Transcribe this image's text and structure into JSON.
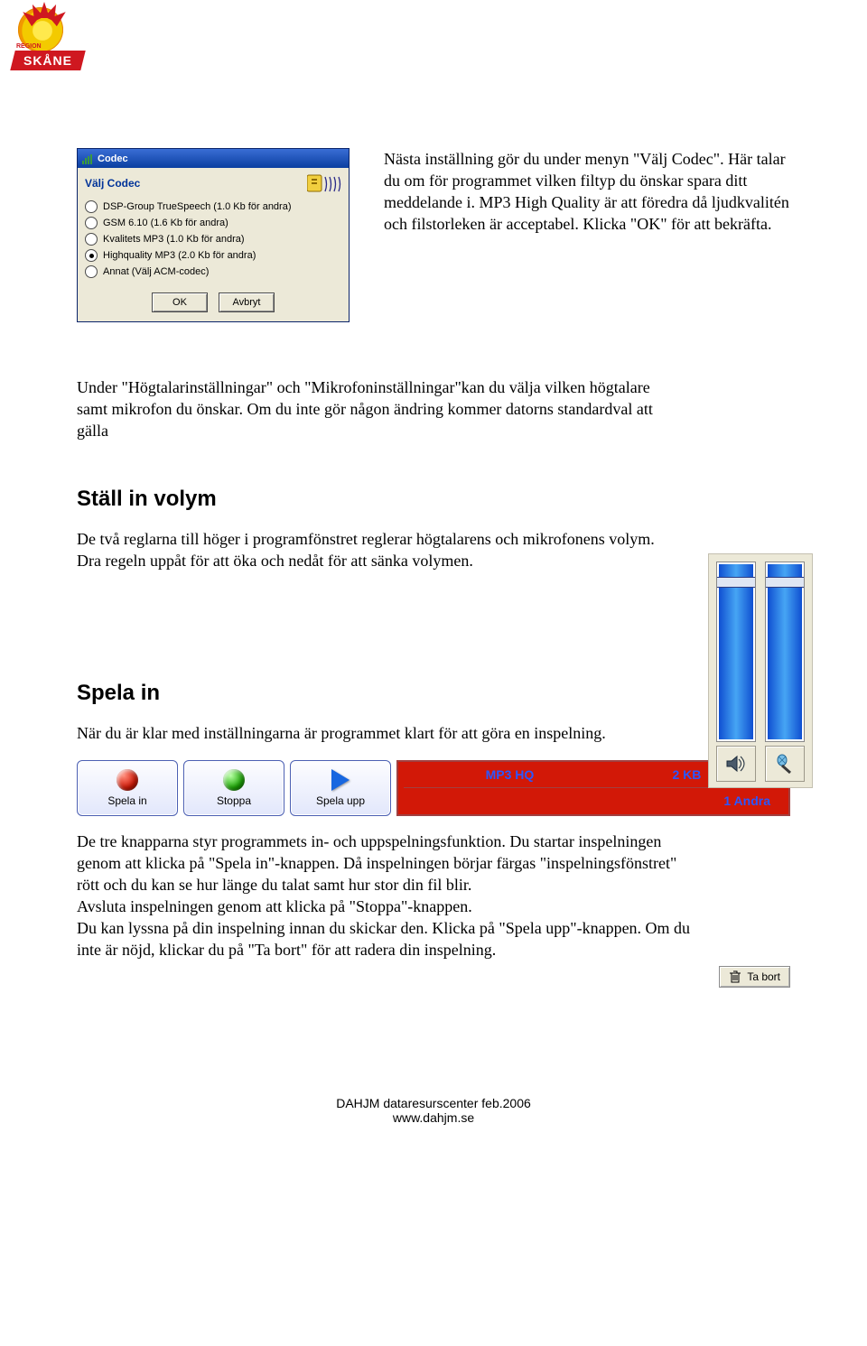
{
  "logo": {
    "region": "REGION",
    "brand": "SKÅNE"
  },
  "codec": {
    "window_title": "Codec",
    "heading": "Välj Codec",
    "options": [
      {
        "label": "DSP-Group TrueSpeech (1.0 Kb för andra)",
        "selected": false
      },
      {
        "label": "GSM 6.10 (1.6 Kb för andra)",
        "selected": false
      },
      {
        "label": "Kvalitets MP3 (1.0 Kb för andra)",
        "selected": false
      },
      {
        "label": "Highquality MP3 (2.0 Kb för andra)",
        "selected": true
      },
      {
        "label": "Annat (Välj ACM-codec)",
        "selected": false
      }
    ],
    "ok": "OK",
    "cancel": "Avbryt"
  },
  "para1": "Nästa inställning gör du under menyn \"Välj Codec\". Här talar du om för programmet vilken filtyp du önskar spara ditt meddelande i. MP3 High Quality är att föredra då ljudkvalitén och filstorleken är acceptabel. Klicka \"OK\" för att bekräfta.",
  "para2": "Under \"Högtalarinställningar\" och \"Mikrofoninställningar\"kan du välja vilken högtalare samt mikrofon du önskar. Om du inte gör någon ändring kommer datorns standardval att gälla",
  "vol": {
    "heading": "Ställ in volym",
    "text": "De två reglarna till höger i programfönstret reglerar högtalarens och mikrofonens volym. Dra regeln uppåt för att öka och nedåt för att sänka volymen."
  },
  "rec": {
    "heading": "Spela in",
    "intro": "När du är klar med inställningarna är programmet klart för att göra en inspelning.",
    "btn_record": "Spela in",
    "btn_stop": "Stoppa",
    "btn_play": "Spela upp",
    "codec": "MP3 HQ",
    "size": "2 KB",
    "other": "1 Andra",
    "text": "De tre knapparna styr programmets in- och uppspelningsfunktion. Du startar inspelningen genom att klicka på \"Spela in\"-knappen. Då inspelningen börjar färgas \"inspelningsfönstret\" rött och du kan se hur länge du talat samt hur stor din fil blir.\nAvsluta inspelningen genom att klicka på \"Stoppa\"-knappen.\nDu kan lyssna på din inspelning innan du skickar den. Klicka på \"Spela upp\"-knappen. Om du inte är nöjd, klickar du på \"Ta bort\" för att radera din inspelning.",
    "delete": "Ta bort"
  },
  "footer": {
    "line1": "DAHJM dataresurscenter feb.2006",
    "line2": "www.dahjm.se"
  }
}
